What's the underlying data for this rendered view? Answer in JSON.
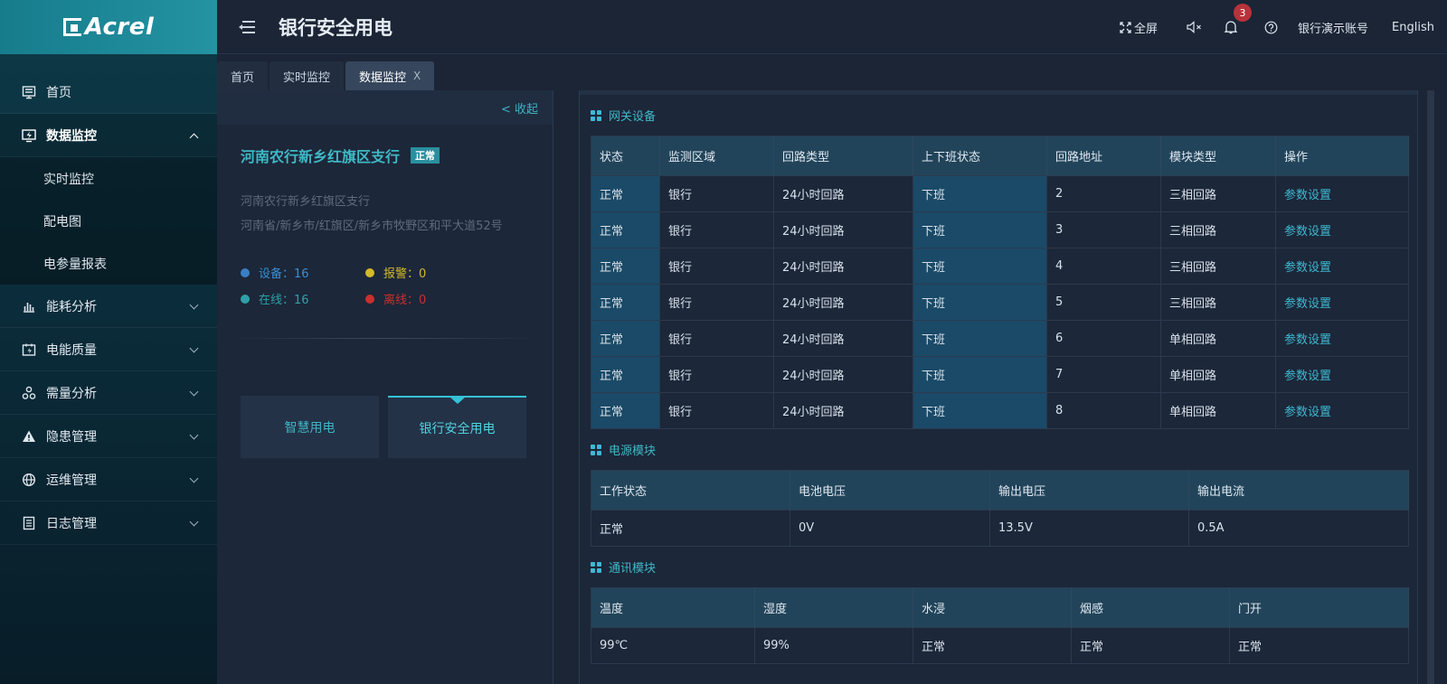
{
  "brand": {
    "logo_text": "Acrel"
  },
  "colors": {
    "accent": "#3fb8c5",
    "alarm": "#d4b92a",
    "offline": "#c8302e",
    "device": "#3a7fc4",
    "online": "#2fa0a8"
  },
  "sidebar": {
    "items": [
      {
        "label": "首页",
        "icon": "home-icon"
      },
      {
        "label": "数据监控",
        "icon": "monitor-icon",
        "expanded": true
      },
      {
        "label": "能耗分析",
        "icon": "bar-chart-icon"
      },
      {
        "label": "电能质量",
        "icon": "calendar-bolt-icon"
      },
      {
        "label": "需量分析",
        "icon": "nodes-icon"
      },
      {
        "label": "隐患管理",
        "icon": "warning-icon"
      },
      {
        "label": "运维管理",
        "icon": "globe-icon"
      },
      {
        "label": "日志管理",
        "icon": "log-icon"
      }
    ],
    "subitems": [
      "实时监控",
      "配电图",
      "电参量报表"
    ]
  },
  "header": {
    "title": "银行安全用电",
    "fullscreen": "全屏",
    "notif_count": "3",
    "account": "银行演示账号",
    "language": "English"
  },
  "tabs": [
    {
      "label": "首页"
    },
    {
      "label": "实时监控"
    },
    {
      "label": "数据监控",
      "active": true,
      "close": "X"
    }
  ],
  "left": {
    "collapse": "< 收起",
    "name": "河南农行新乡红旗区支行",
    "status": "正常",
    "sub_name": "河南农行新乡红旗区支行",
    "address": "河南省/新乡市/红旗区/新乡市牧野区和平大道52号",
    "stats": {
      "devices": "设备：16",
      "alarms": "报警：0",
      "online": "在线：16",
      "offline": "离线：0"
    },
    "cards": [
      "智慧用电",
      "银行安全用电"
    ]
  },
  "gateway": {
    "title": "网关设备",
    "headers": [
      "状态",
      "监测区域",
      "回路类型",
      "上下班状态",
      "回路地址",
      "模块类型",
      "操作"
    ],
    "rows": [
      [
        "正常",
        "银行",
        "24小时回路",
        "下班",
        "2",
        "三相回路",
        "参数设置"
      ],
      [
        "正常",
        "银行",
        "24小时回路",
        "下班",
        "3",
        "三相回路",
        "参数设置"
      ],
      [
        "正常",
        "银行",
        "24小时回路",
        "下班",
        "4",
        "三相回路",
        "参数设置"
      ],
      [
        "正常",
        "银行",
        "24小时回路",
        "下班",
        "5",
        "三相回路",
        "参数设置"
      ],
      [
        "正常",
        "银行",
        "24小时回路",
        "下班",
        "6",
        "单相回路",
        "参数设置"
      ],
      [
        "正常",
        "银行",
        "24小时回路",
        "下班",
        "7",
        "单相回路",
        "参数设置"
      ],
      [
        "正常",
        "银行",
        "24小时回路",
        "下班",
        "8",
        "单相回路",
        "参数设置"
      ]
    ]
  },
  "power": {
    "title": "电源模块",
    "headers": [
      "工作状态",
      "电池电压",
      "输出电压",
      "输出电流"
    ],
    "row": [
      "正常",
      "0V",
      "13.5V",
      "0.5A"
    ]
  },
  "comm": {
    "title": "通讯模块",
    "headers": [
      "温度",
      "湿度",
      "水浸",
      "烟感",
      "门开"
    ],
    "row": [
      "99℃",
      "99%",
      "正常",
      "正常",
      "正常"
    ]
  }
}
